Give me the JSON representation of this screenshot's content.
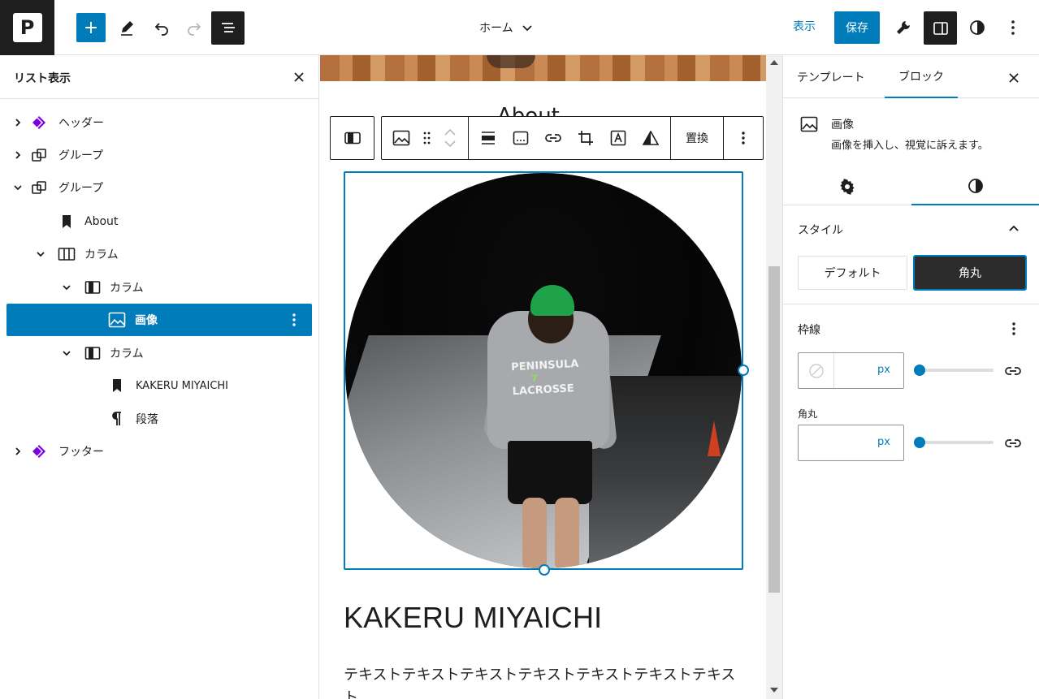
{
  "topbar": {
    "site_logo_letter": "P",
    "document_title": "ホーム",
    "view_label": "表示",
    "save_label": "保存"
  },
  "list_view": {
    "title": "リスト表示",
    "items": [
      {
        "label": "ヘッダー",
        "icon": "template-part-icon",
        "expanded": false
      },
      {
        "label": "グループ",
        "icon": "group-icon",
        "expanded": false
      },
      {
        "label": "グループ",
        "icon": "group-icon",
        "expanded": true
      },
      {
        "label": "About",
        "icon": "bookmark-heading-icon"
      },
      {
        "label": "カラム",
        "icon": "columns-icon",
        "expanded": true
      },
      {
        "label": "カラム",
        "icon": "column-icon",
        "expanded": true
      },
      {
        "label": "画像",
        "icon": "image-icon",
        "selected": true
      },
      {
        "label": "カラム",
        "icon": "column-icon",
        "expanded": true
      },
      {
        "label": "KAKERU MIYAICHI",
        "icon": "bookmark-heading-icon"
      },
      {
        "label": "段落",
        "icon": "paragraph-icon"
      },
      {
        "label": "フッター",
        "icon": "template-part-icon",
        "expanded": false
      }
    ]
  },
  "canvas": {
    "about_peek": "About",
    "toolbar": {
      "replace_label": "置換"
    },
    "image": {
      "hoodie_text_line1": "PENINSULA",
      "hoodie_text_line2": "LACROSSE",
      "hoodie_number": "7"
    },
    "heading": "KAKERU MIYAICHI",
    "paragraph": "テキストテキストテキストテキストテキストテキストテキスト"
  },
  "sidebar": {
    "tabs": [
      "テンプレート",
      "ブロック"
    ],
    "active_tab": "ブロック",
    "block_title": "画像",
    "block_description": "画像を挿入し、視覚に訴えます。",
    "style_panel": {
      "title": "スタイル",
      "options": [
        "デフォルト",
        "角丸"
      ],
      "selected": "角丸"
    },
    "border_panel": {
      "title": "枠線",
      "width_unit": "px",
      "radius_label": "角丸",
      "radius_unit": "px"
    }
  },
  "colors": {
    "accent": "#007cba",
    "dark": "#1e1e1e",
    "template_part": "#7a00df"
  }
}
